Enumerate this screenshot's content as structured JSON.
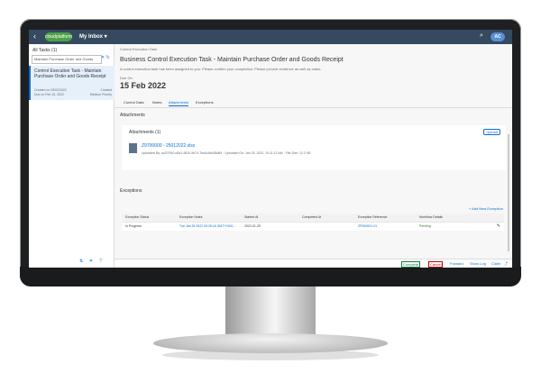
{
  "shell": {
    "title": "My Inbox ▾",
    "logo": "cloudplatform",
    "avatar": "AC"
  },
  "master": {
    "header": "All Tasks (1)",
    "search": "Maintain Purchase Order and Goods",
    "item": {
      "title": "Control Execution Task - Maintain Purchase Order and Goods Receipt",
      "row1_left": "Created on 03/02/2022",
      "row1_right": "Created",
      "row2_left": "Due on Feb 15, 2022",
      "row2_right": "Medium Priority"
    }
  },
  "detail": {
    "breadcrumb": "Control Execution Task",
    "title": "Business Control Execution Task - Maintain Purchase Order and Goods Receipt",
    "subtitle": "A control execution task has been assigned to you. Please confirm your completion. Please provide evidence as well as notes.",
    "due_label": "Due On",
    "due": "15 Feb 2022",
    "tabs": [
      "Control Data",
      "Notes",
      "Attachments",
      "Exceptions"
    ]
  },
  "attachments": {
    "section": "Attachments",
    "header": "Attachments (1)",
    "upload": "Upload",
    "file_name": "Z9700000 - 25012022.xlsx",
    "file_meta": "Uploaded By: ac207f40-c8a1-4810-9b74-7ba4c6bd38d84 · Uploaded On: Jan 25, 2022, 10:11:12 AM · File Size: 12.2 KB"
  },
  "exceptions": {
    "section": "Exceptions",
    "add": "+ Add New Exception",
    "columns": [
      "Exception Status",
      "Exception Notes",
      "Started At",
      "Completed At",
      "Exception Reference",
      "Workflow Details"
    ],
    "row": [
      "In Progress",
      "Tue Jan 25 2022 09:25:16 GMT+0100...",
      "2022-01-25",
      "",
      "ZP000001-01",
      "Pending"
    ]
  },
  "footer": {
    "accept": "Complete",
    "reject": "Cancel",
    "forward": "Forward",
    "show_log": "Show Log",
    "claim": "Claim"
  }
}
